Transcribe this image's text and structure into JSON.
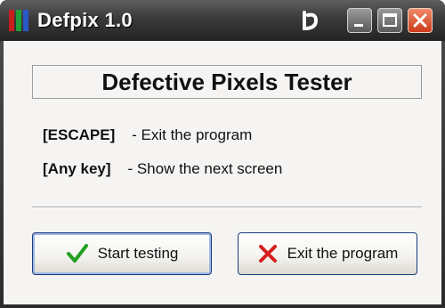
{
  "window": {
    "title": "Defpix 1.0",
    "app_icon_colors": [
      "#c81e1e",
      "#1ea03a",
      "#2a5ac8"
    ],
    "title_buttons": [
      "minimize-icon",
      "maximize-icon",
      "close-icon"
    ]
  },
  "main": {
    "header": "Defective Pixels Tester",
    "shortcuts": [
      {
        "key": "[ESCAPE]",
        "desc": "- Exit the program"
      },
      {
        "key": "[Any key]",
        "desc": "- Show the next screen"
      }
    ]
  },
  "buttons": {
    "start": {
      "label": "Start testing",
      "icon": "check-icon",
      "icon_color": "#22a022"
    },
    "exit": {
      "label": "Exit the program",
      "icon": "x-icon",
      "icon_color": "#d62020"
    }
  }
}
